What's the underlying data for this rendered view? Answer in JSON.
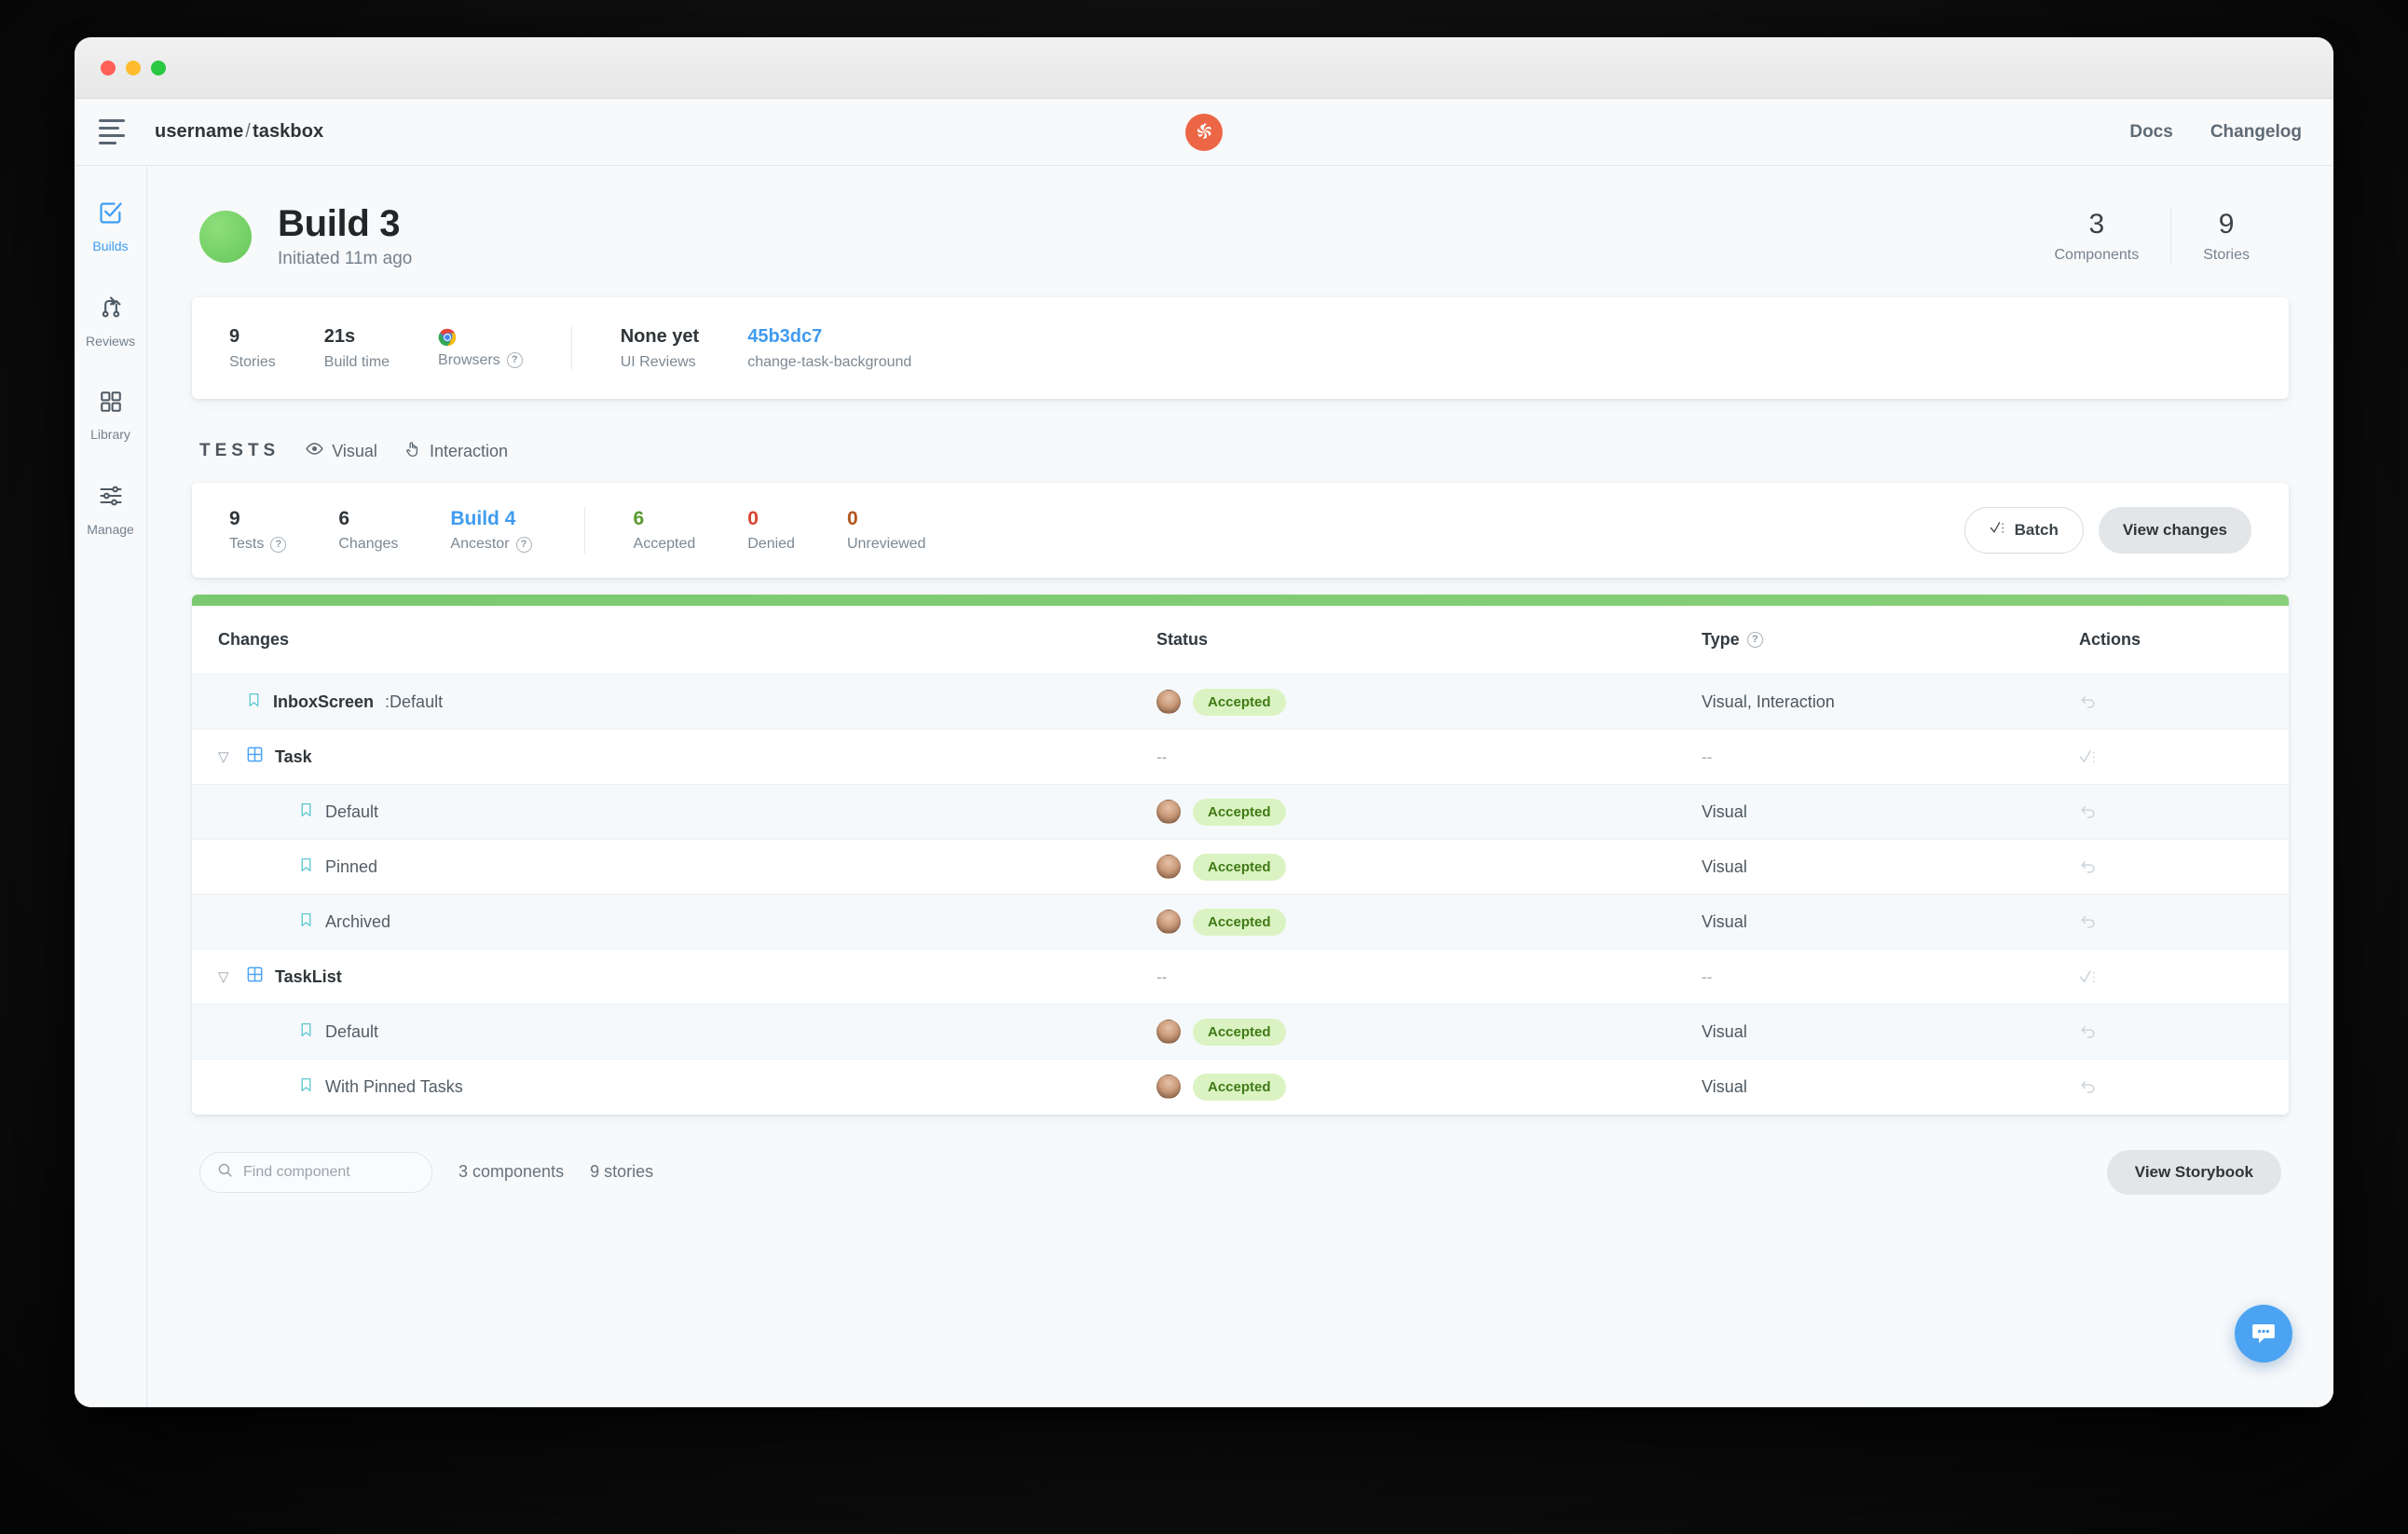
{
  "window": {
    "traffic_lights": [
      "close",
      "minimize",
      "zoom"
    ]
  },
  "header": {
    "menu_icon": "hamburger-icon",
    "breadcrumb_owner": "username",
    "breadcrumb_sep": "/",
    "breadcrumb_project": "taskbox",
    "logo": "chromatic-logo",
    "links": [
      {
        "label": "Docs"
      },
      {
        "label": "Changelog"
      }
    ]
  },
  "sidebar": {
    "items": [
      {
        "label": "Builds",
        "icon": "check-square-icon",
        "active": true
      },
      {
        "label": "Reviews",
        "icon": "branch-merge-icon",
        "active": false
      },
      {
        "label": "Library",
        "icon": "grid-squares-icon",
        "active": false
      },
      {
        "label": "Manage",
        "icon": "sliders-icon",
        "active": false
      }
    ]
  },
  "build": {
    "status_color": "#6ecb5d",
    "title": "Build 3",
    "subtitle": "Initiated 11m ago",
    "head_stats": [
      {
        "num": "3",
        "label": "Components"
      },
      {
        "num": "9",
        "label": "Stories"
      }
    ]
  },
  "info_card": {
    "items": [
      {
        "value": "9",
        "label": "Stories",
        "kind": "text"
      },
      {
        "value": "21s",
        "label": "Build time",
        "kind": "text"
      },
      {
        "value": "",
        "label": "Browsers",
        "kind": "browser",
        "help": true
      },
      {
        "value": "None yet",
        "label": "UI Reviews",
        "kind": "text",
        "after_divider": true
      },
      {
        "value": "45b3dc7",
        "label": "change-task-background",
        "kind": "link"
      }
    ]
  },
  "tests": {
    "heading": "TESTS",
    "tabs": [
      {
        "label": "Visual",
        "icon": "eye-icon"
      },
      {
        "label": "Interaction",
        "icon": "pointer-hand-icon"
      }
    ],
    "summary": [
      {
        "num": "9",
        "label": "Tests",
        "help": true,
        "tone": "dark"
      },
      {
        "num": "6",
        "label": "Changes",
        "help": false,
        "tone": "dark"
      },
      {
        "num": "Build 4",
        "label": "Ancestor",
        "help": true,
        "tone": "blue"
      },
      {
        "num": "6",
        "label": "Accepted",
        "help": false,
        "tone": "green",
        "after_divider": true
      },
      {
        "num": "0",
        "label": "Denied",
        "help": false,
        "tone": "red"
      },
      {
        "num": "0",
        "label": "Unreviewed",
        "help": false,
        "tone": "orange"
      }
    ],
    "batch_label": "Batch",
    "view_changes_label": "View changes"
  },
  "table": {
    "columns": [
      "Changes",
      "Status",
      "Type",
      "Actions"
    ],
    "type_help": true,
    "progress_color": "#7bc96f",
    "rows": [
      {
        "name": "InboxScreen",
        "suffix": ":Default",
        "level": 0,
        "icon": "bookmark-icon",
        "chevron": false,
        "bold": true,
        "status": "Accepted",
        "avatar": true,
        "type": "Visual, Interaction",
        "action": "undo-icon",
        "alt": true
      },
      {
        "name": "Task",
        "suffix": "",
        "level": 0,
        "icon": "component-grid-icon",
        "chevron": true,
        "bold": true,
        "status": "--",
        "avatar": false,
        "type": "--",
        "action": "batch-check-icon",
        "alt": false
      },
      {
        "name": "Default",
        "suffix": "",
        "level": 1,
        "icon": "bookmark-icon",
        "chevron": false,
        "bold": false,
        "status": "Accepted",
        "avatar": true,
        "type": "Visual",
        "action": "undo-icon",
        "alt": true
      },
      {
        "name": "Pinned",
        "suffix": "",
        "level": 1,
        "icon": "bookmark-icon",
        "chevron": false,
        "bold": false,
        "status": "Accepted",
        "avatar": true,
        "type": "Visual",
        "action": "undo-icon",
        "alt": false
      },
      {
        "name": "Archived",
        "suffix": "",
        "level": 1,
        "icon": "bookmark-icon",
        "chevron": false,
        "bold": false,
        "status": "Accepted",
        "avatar": true,
        "type": "Visual",
        "action": "undo-icon",
        "alt": true
      },
      {
        "name": "TaskList",
        "suffix": "",
        "level": 0,
        "icon": "component-grid-icon",
        "chevron": true,
        "bold": true,
        "status": "--",
        "avatar": false,
        "type": "--",
        "action": "batch-check-icon",
        "alt": false
      },
      {
        "name": "Default",
        "suffix": "",
        "level": 1,
        "icon": "bookmark-icon",
        "chevron": false,
        "bold": false,
        "status": "Accepted",
        "avatar": true,
        "type": "Visual",
        "action": "undo-icon",
        "alt": true
      },
      {
        "name": "With Pinned Tasks",
        "suffix": "",
        "level": 1,
        "icon": "bookmark-icon",
        "chevron": false,
        "bold": false,
        "status": "Accepted",
        "avatar": true,
        "type": "Visual",
        "action": "undo-icon",
        "alt": false
      }
    ]
  },
  "footer": {
    "search_placeholder": "Find component",
    "search_value": "",
    "components_count": "3 components",
    "stories_count": "9 stories",
    "view_storybook_label": "View Storybook",
    "chat_icon": "chat-bubble-icon"
  }
}
